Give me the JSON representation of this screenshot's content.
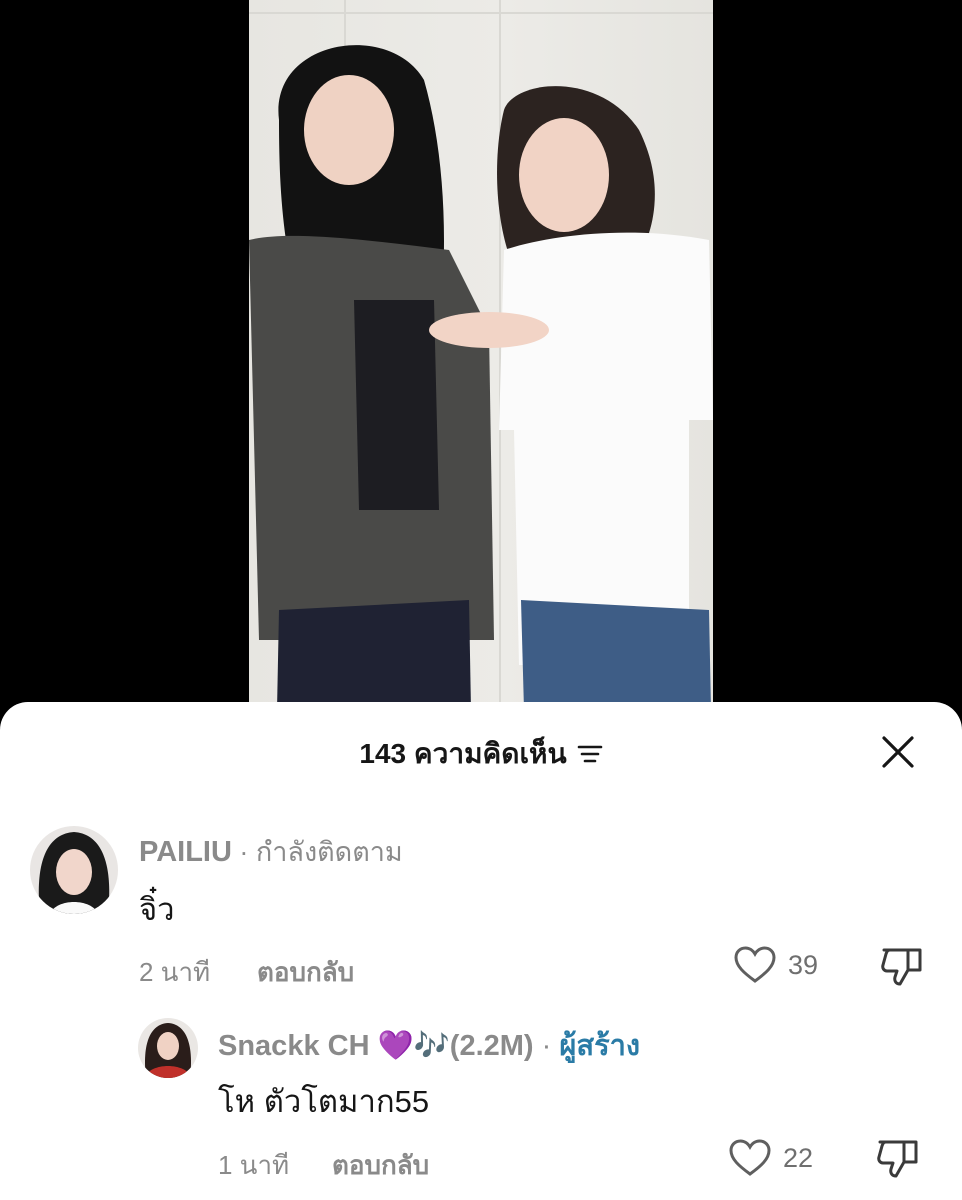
{
  "sheet": {
    "count": "143",
    "title": "ความคิดเห็น"
  },
  "comments": [
    {
      "username": "PAILIU",
      "status": " · กำลังติดตาม",
      "text": "จิ๋ว",
      "time": "2 นาที",
      "reply_label": "ตอบกลับ",
      "likes": "39"
    },
    {
      "username": "Snackk CH",
      "emoji": "💜",
      "notes": "🎶",
      "followers": "(2.2M)",
      "separator": " · ",
      "role": "ผู้สร้าง",
      "text": "โห ตัวโตมาก55",
      "time": "1 นาที",
      "reply_label": "ตอบกลับ",
      "likes": "22"
    }
  ],
  "colors": {
    "accent_creator": "#2a7ba6",
    "purple_heart": "#9b3fe0"
  }
}
